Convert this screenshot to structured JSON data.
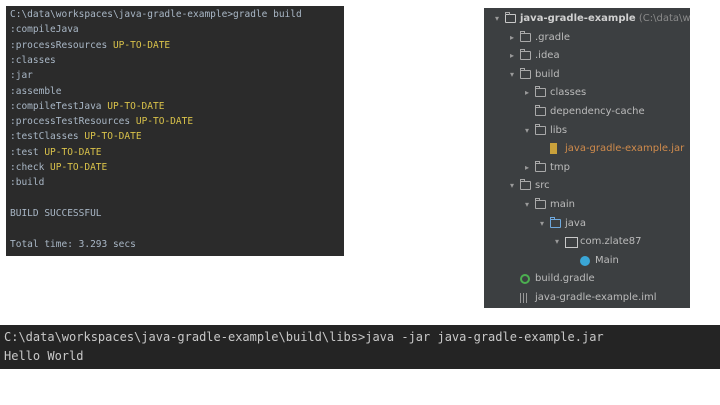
{
  "gradle_terminal": {
    "lines": [
      {
        "text": "C:\\data\\workspaces\\java-gradle-example>gradle build",
        "status": ""
      },
      {
        "text": ":compileJava",
        "status": ""
      },
      {
        "text": ":processResources ",
        "status": "UP-TO-DATE"
      },
      {
        "text": ":classes",
        "status": ""
      },
      {
        "text": ":jar",
        "status": ""
      },
      {
        "text": ":assemble",
        "status": ""
      },
      {
        "text": ":compileTestJava ",
        "status": "UP-TO-DATE"
      },
      {
        "text": ":processTestResources ",
        "status": "UP-TO-DATE"
      },
      {
        "text": ":testClasses ",
        "status": "UP-TO-DATE"
      },
      {
        "text": ":test ",
        "status": "UP-TO-DATE"
      },
      {
        "text": ":check ",
        "status": "UP-TO-DATE"
      },
      {
        "text": ":build",
        "status": ""
      },
      {
        "text": "",
        "status": ""
      },
      {
        "text": "BUILD SUCCESSFUL",
        "status": ""
      },
      {
        "text": "",
        "status": ""
      },
      {
        "text": "Total time: 3.293 secs",
        "status": ""
      }
    ]
  },
  "project_tree": {
    "items": [
      {
        "label": "java-gradle-example",
        "path": " (C:\\data\\work",
        "icon": "project-folder-icon",
        "arrow": "▾",
        "depth": 0
      },
      {
        "label": ".gradle",
        "icon": "folder-icon",
        "arrow": "▸",
        "depth": 1
      },
      {
        "label": ".idea",
        "icon": "folder-icon",
        "arrow": "▸",
        "depth": 1
      },
      {
        "label": "build",
        "icon": "folder-icon",
        "arrow": "▾",
        "depth": 1
      },
      {
        "label": "classes",
        "icon": "folder-icon",
        "arrow": "▸",
        "depth": 2
      },
      {
        "label": "dependency-cache",
        "icon": "folder-icon",
        "arrow": "",
        "depth": 2
      },
      {
        "label": "libs",
        "icon": "folder-icon",
        "arrow": "▾",
        "depth": 2
      },
      {
        "label": "java-gradle-example.jar",
        "icon": "jar-icon",
        "arrow": "",
        "depth": 3
      },
      {
        "label": "tmp",
        "icon": "folder-icon",
        "arrow": "▸",
        "depth": 2
      },
      {
        "label": "src",
        "icon": "folder-icon",
        "arrow": "▾",
        "depth": 1
      },
      {
        "label": "main",
        "icon": "folder-icon",
        "arrow": "▾",
        "depth": 2
      },
      {
        "label": "java",
        "icon": "source-folder-icon",
        "arrow": "▾",
        "depth": 3
      },
      {
        "label": "com.zlate87",
        "icon": "package-icon",
        "arrow": "▾",
        "depth": 4
      },
      {
        "label": "Main",
        "icon": "class-icon",
        "arrow": "",
        "depth": 5
      },
      {
        "label": "build.gradle",
        "icon": "gradle-icon",
        "arrow": "",
        "depth": 1
      },
      {
        "label": "java-gradle-example.iml",
        "icon": "iml-icon",
        "arrow": "",
        "depth": 1
      }
    ]
  },
  "run_terminal": {
    "lines": [
      "C:\\data\\workspaces\\java-gradle-example\\build\\libs>java -jar java-gradle-example.jar",
      "Hello World"
    ]
  },
  "colors": {
    "terminal_bg": "#2b2b2b",
    "status_color": "#d9c24a",
    "tree_bg": "#3c3f41",
    "jar_label_color": "#d08b4c"
  }
}
